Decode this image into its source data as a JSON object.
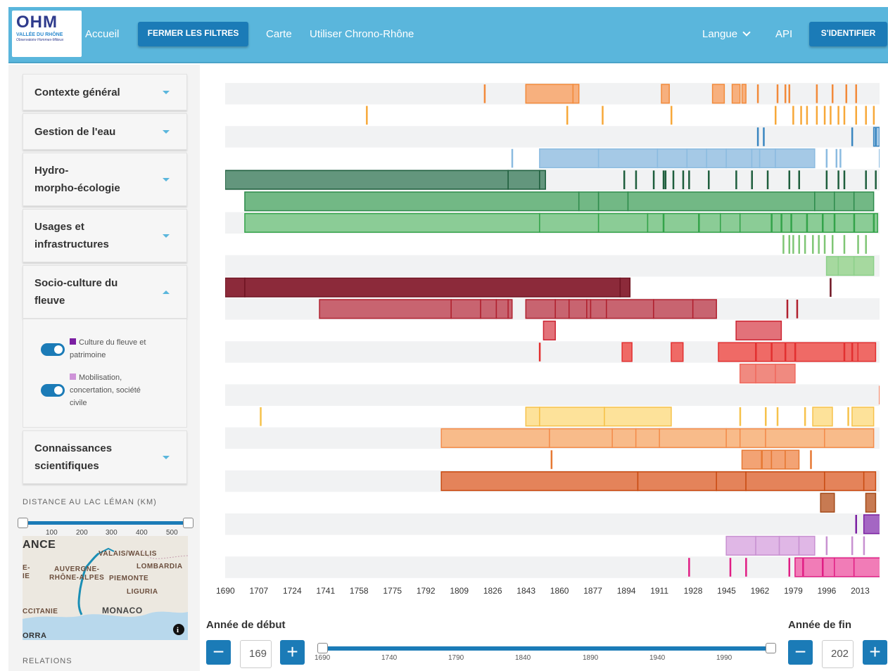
{
  "header": {
    "logo_title": "OHM",
    "logo_sub": "VALLÉE DU RHÔNE",
    "logo_sub2": "Observatoire Hommes-Milieux",
    "nav": {
      "home": "Accueil",
      "close_filters": "FERMER LES FILTRES",
      "map": "Carte",
      "use": "Utiliser Chrono-Rhône",
      "language": "Langue",
      "api": "API",
      "login": "S'IDENTIFIER"
    }
  },
  "sidebar": {
    "accordions": [
      {
        "title": "Contexte général"
      },
      {
        "title": "Gestion de l'eau"
      },
      {
        "title_l1": "Hydro-",
        "title_l2": "morpho-écologie"
      },
      {
        "title_l1": "Usages et",
        "title_l2": "infrastructures"
      },
      {
        "title_l1": "Socio-culture du",
        "title_l2": "fleuve"
      },
      {
        "title_l1": "Connaissances",
        "title_l2": "scientifiques"
      }
    ],
    "toggles": [
      {
        "label_l1": "Culture du fleuve et",
        "label_l2": "patrimoine",
        "color": "#7b1fa2",
        "on": true
      },
      {
        "label_l1": "Mobilisation,",
        "label_l2": "concertation, société",
        "label_l3": "civile",
        "color": "#ce93d8",
        "on": true
      }
    ],
    "distance_title": "DISTANCE AU LAC LÉMAN (KM)",
    "distance_ticks": [
      "100",
      "200",
      "300",
      "400",
      "500"
    ],
    "map_labels": [
      "ANCE",
      "VALAIS/WALLIS",
      "E-",
      "IE",
      "AUVERGNE-",
      "RHÔNE-ALPES",
      "PIEMONTE",
      "LOMBARDIA",
      "LIGURIA",
      "CCITANIE",
      "MONACO",
      "ORRA"
    ],
    "relations_title": "RELATIONS"
  },
  "timeline": {
    "x_ticks": [
      "1690",
      "1707",
      "1724",
      "1741",
      "1758",
      "1775",
      "1792",
      "1809",
      "1826",
      "1843",
      "1860",
      "1877",
      "1894",
      "1911",
      "1928",
      "1945",
      "1962",
      "1979",
      "1996",
      "2013"
    ],
    "x_start": 1690,
    "x_end": 2023
  },
  "controls": {
    "start_label": "Année de début",
    "end_label": "Année de fin",
    "start_value": "169",
    "end_value": "202",
    "minus": "−",
    "plus": "+",
    "range_ticks": [
      "1690",
      "1740",
      "1790",
      "1840",
      "1890",
      "1940",
      "1990"
    ]
  }
}
